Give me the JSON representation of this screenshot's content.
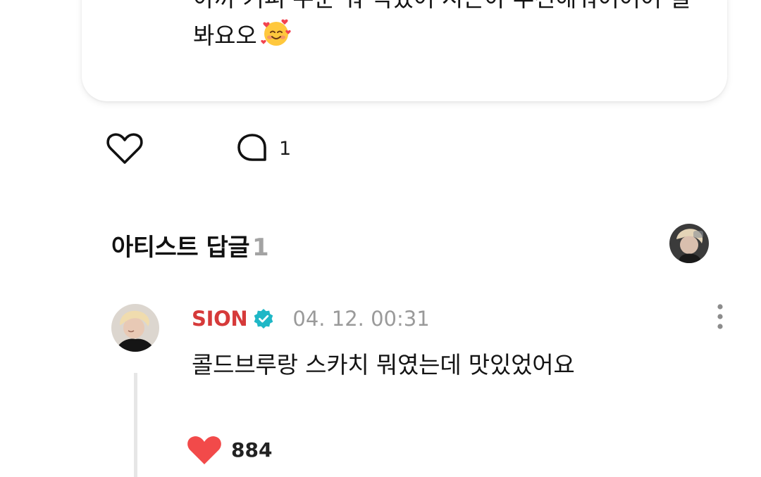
{
  "post": {
    "text_line1": "아까 커피 주문 뭐 먹었어 시온아 추천해줘어어어 낼",
    "text_line2": "봐요오",
    "emoji": "smiling-face-with-hearts-emoji",
    "comment_count": "1"
  },
  "artist_replies": {
    "title": "아티스트 답글",
    "count": "1"
  },
  "reply": {
    "author": "SION",
    "timestamp": "04. 12. 00:31",
    "text": "콜드브루랑 스카치 뭐였는데 맛있었어요",
    "like_count": "884"
  },
  "colors": {
    "author": "#d63a3a",
    "verified": "#1fb7c6",
    "heart_filled": "#f24a4a",
    "muted": "#9a9a9a"
  },
  "icons": [
    "heart-outline-icon",
    "comment-bubble-icon",
    "verified-badge-icon",
    "more-vertical-icon",
    "heart-filled-icon"
  ]
}
